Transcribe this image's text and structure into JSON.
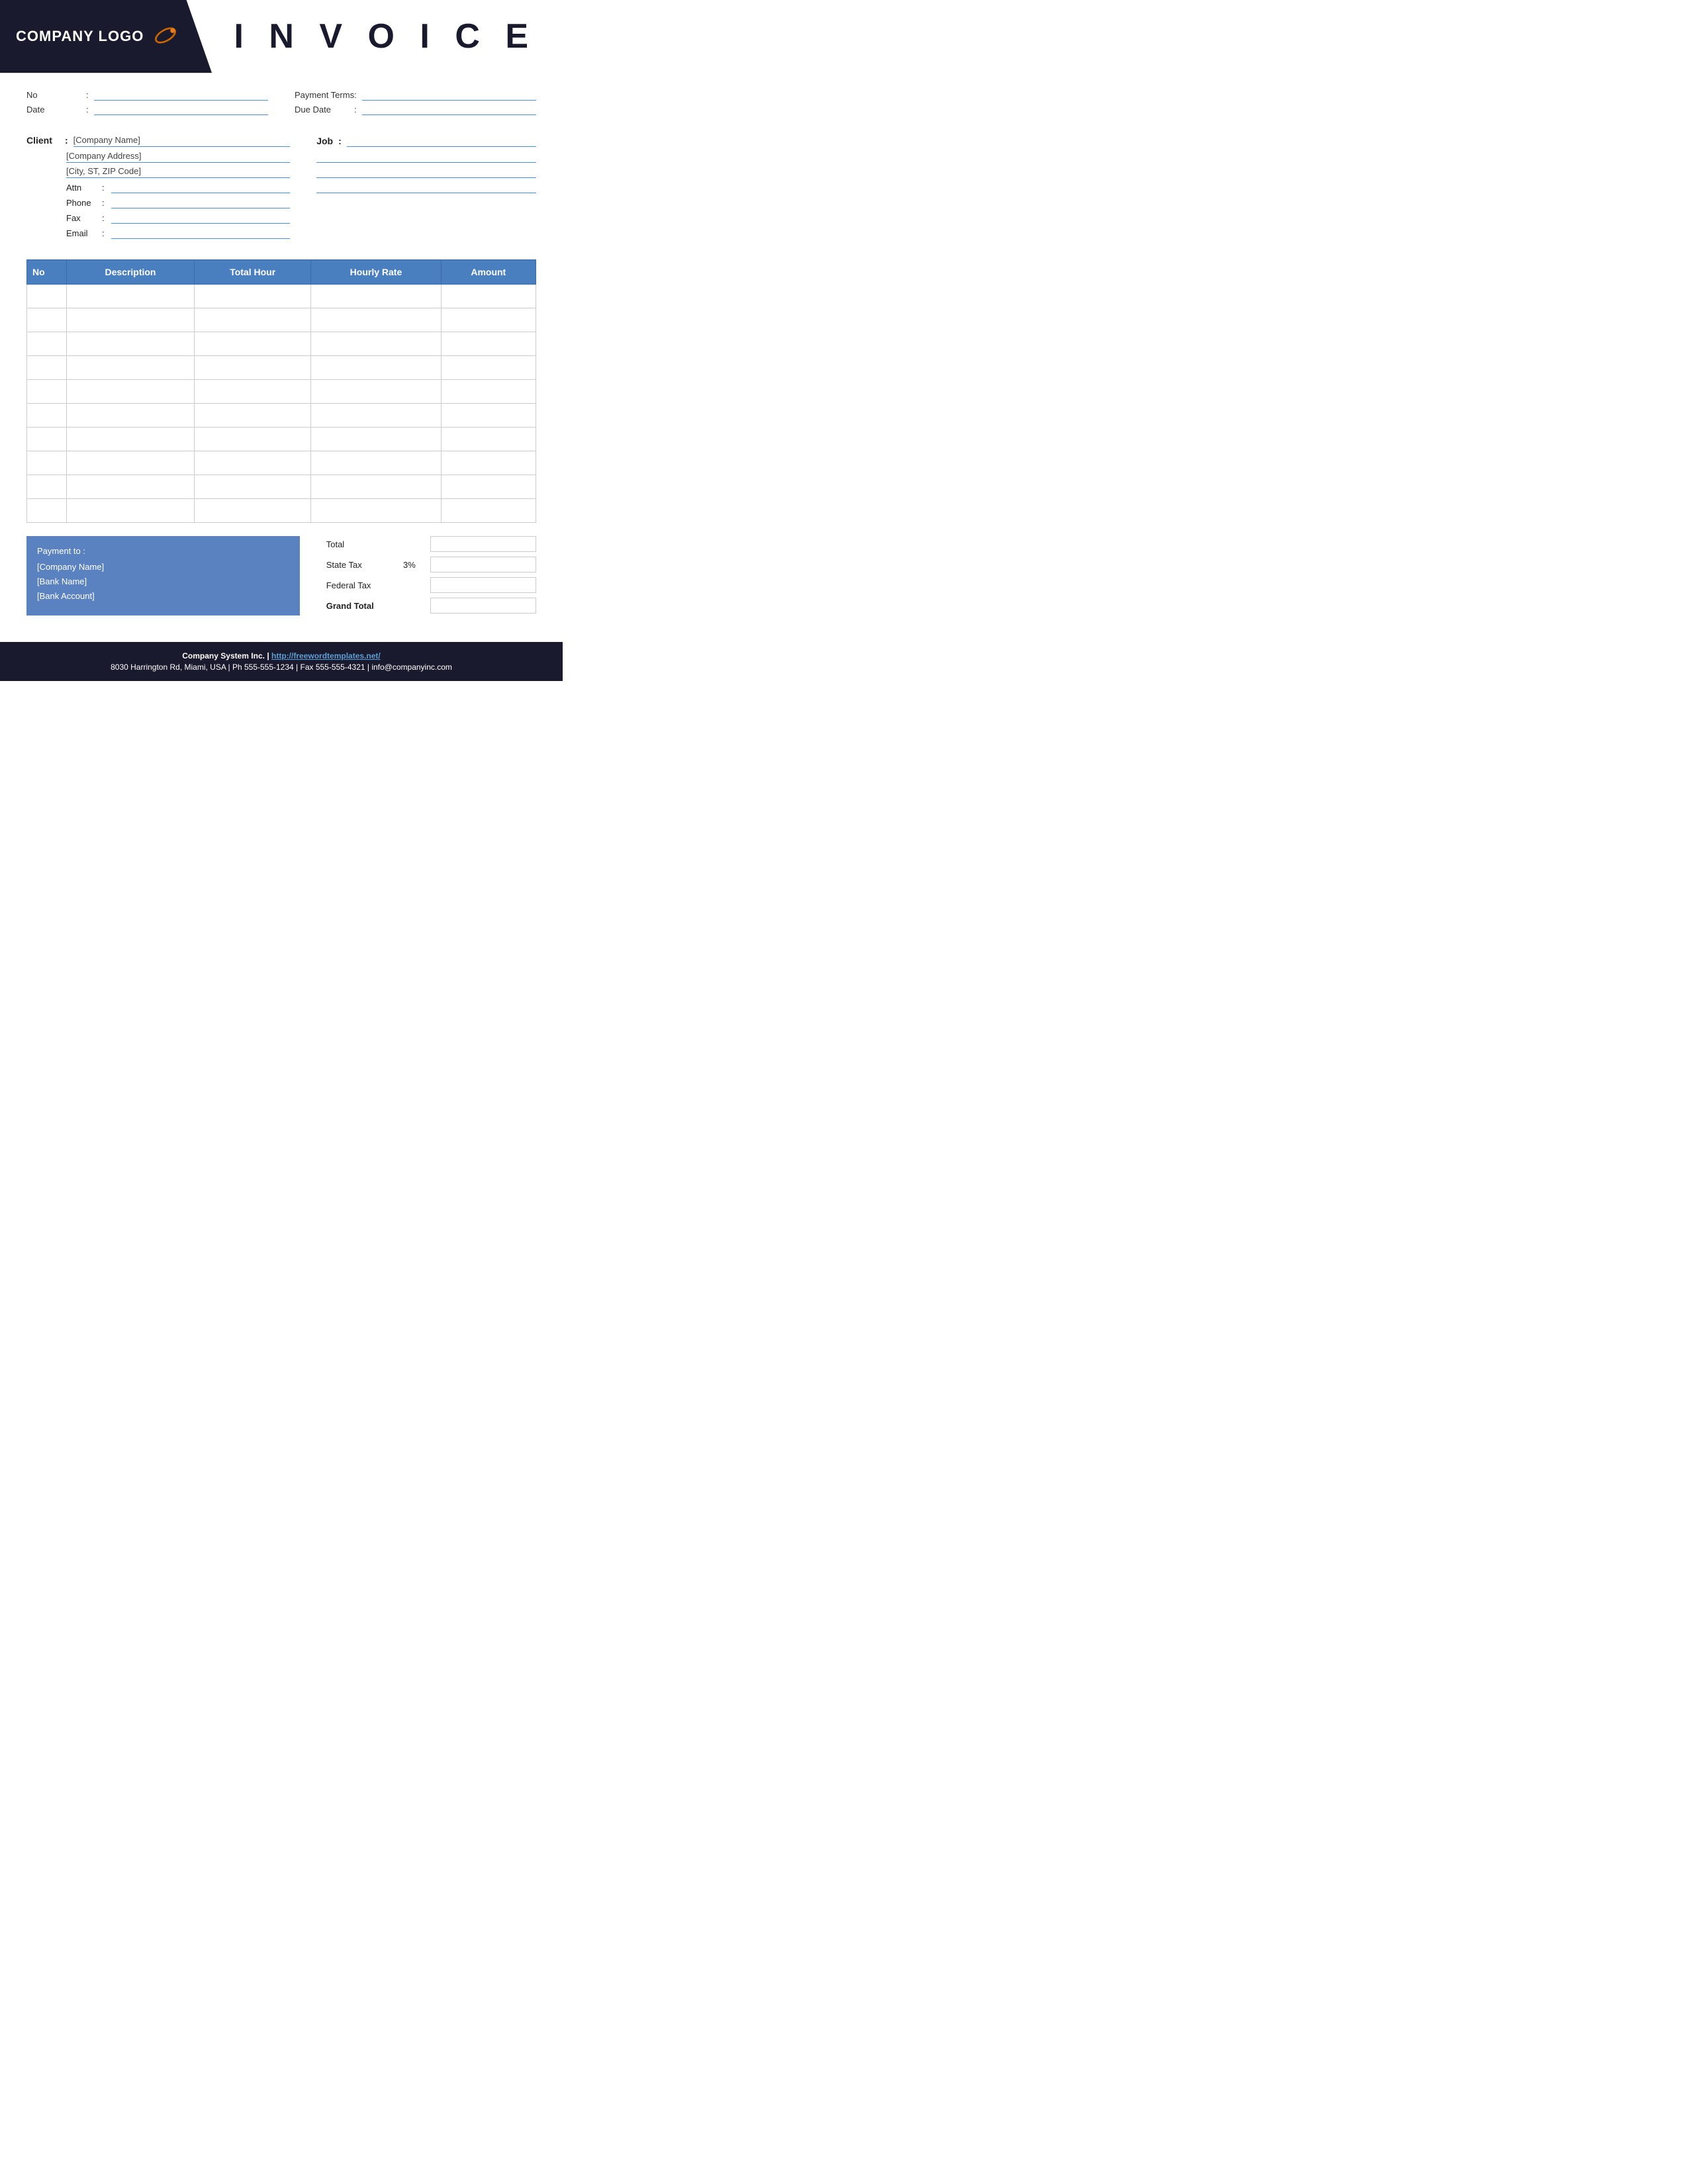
{
  "header": {
    "logo_text": "COMPANY LOGO",
    "invoice_title": "I N V O I C E"
  },
  "meta_fields": {
    "no_label": "No",
    "date_label": "Date",
    "payment_terms_label": "Payment  Terms",
    "due_date_label": "Due Date"
  },
  "client": {
    "label": "Client",
    "company_name": "[Company Name]",
    "company_address": "[Company Address]",
    "city_zip": "[City, ST, ZIP Code]",
    "attn_label": "Attn",
    "phone_label": "Phone",
    "fax_label": "Fax",
    "email_label": "Email"
  },
  "job": {
    "label": "Job"
  },
  "table": {
    "headers": [
      "No",
      "Description",
      "Total Hour",
      "Hourly Rate",
      "Amount"
    ],
    "rows": [
      {
        "no": "",
        "description": "",
        "total_hour": "",
        "hourly_rate": "",
        "amount": ""
      },
      {
        "no": "",
        "description": "",
        "total_hour": "",
        "hourly_rate": "",
        "amount": ""
      },
      {
        "no": "",
        "description": "",
        "total_hour": "",
        "hourly_rate": "",
        "amount": ""
      },
      {
        "no": "",
        "description": "",
        "total_hour": "",
        "hourly_rate": "",
        "amount": ""
      },
      {
        "no": "",
        "description": "",
        "total_hour": "",
        "hourly_rate": "",
        "amount": ""
      },
      {
        "no": "",
        "description": "",
        "total_hour": "",
        "hourly_rate": "",
        "amount": ""
      },
      {
        "no": "",
        "description": "",
        "total_hour": "",
        "hourly_rate": "",
        "amount": ""
      },
      {
        "no": "",
        "description": "",
        "total_hour": "",
        "hourly_rate": "",
        "amount": ""
      },
      {
        "no": "",
        "description": "",
        "total_hour": "",
        "hourly_rate": "",
        "amount": ""
      },
      {
        "no": "",
        "description": "",
        "total_hour": "",
        "hourly_rate": "",
        "amount": ""
      }
    ]
  },
  "payment": {
    "title": "Payment to :",
    "company_name": "[Company Name]",
    "bank_name": "[Bank Name]",
    "bank_account": "[Bank Account]"
  },
  "totals": {
    "total_label": "Total",
    "state_tax_label": "State Tax",
    "state_tax_percent": "3%",
    "federal_tax_label": "Federal Tax",
    "grand_total_label": "Grand Total"
  },
  "footer": {
    "company": "Company System Inc.",
    "separator": "|",
    "website": "http://freewordtemplates.net/",
    "address": "8030 Harrington Rd, Miami, USA | Ph 555-555-1234 | Fax 555-555-4321 | info@companyinc.com"
  }
}
